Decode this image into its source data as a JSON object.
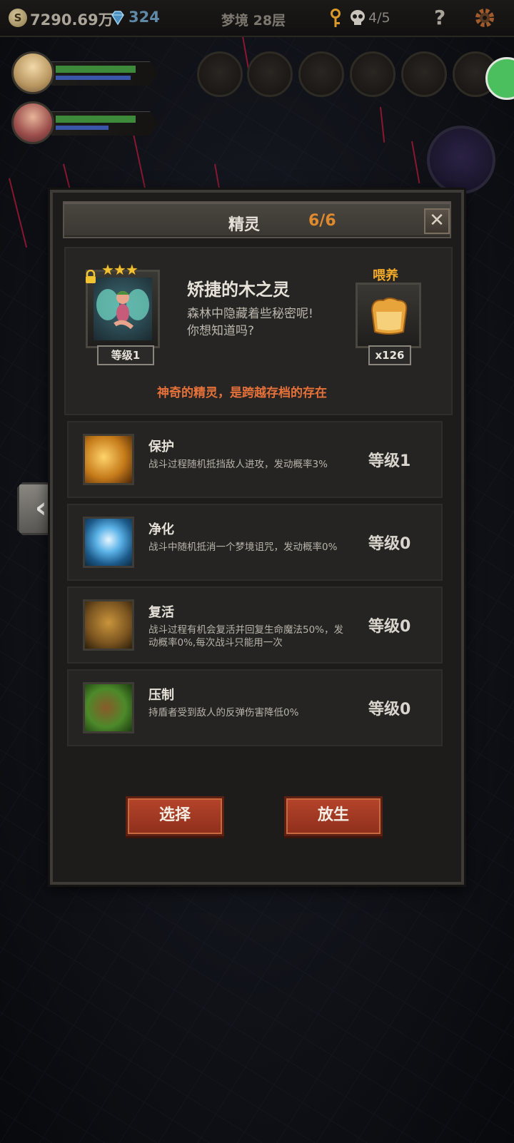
{
  "topbar": {
    "coin_symbol": "S",
    "gold": "7290.69万",
    "gems": "324",
    "floor": "梦境 28层",
    "keys": "4/5",
    "help_label": "?"
  },
  "heroes": [
    {
      "hp_fraction": 0.9,
      "mp_fraction": 0.85
    },
    {
      "hp_fraction": 0.9,
      "mp_fraction": 0.6
    }
  ],
  "dialog": {
    "title": "精灵",
    "count": "6/6",
    "close_label": "✕",
    "spirit": {
      "stars": "★★★",
      "level": "等级1",
      "name": "矫捷的木之灵",
      "desc_line1": "森林中隐藏着些秘密呢!",
      "desc_line2": "你想知道吗?",
      "feed_label": "喂养",
      "feed_count": "x126",
      "tagline": "神奇的精灵，是跨越存档的存在"
    },
    "skills": [
      {
        "name": "保护",
        "desc": "战斗过程随机抵挡敌人进攻，发动概率3%",
        "level": "等级1",
        "icon": "protect-icon"
      },
      {
        "name": "净化",
        "desc": "战斗中随机抵消一个梦境诅咒，发动概率0%",
        "level": "等级0",
        "icon": "purify-icon"
      },
      {
        "name": "复活",
        "desc": "战斗过程有机会复活并回复生命魔法50%，发动概率0%,每次战斗只能用一次",
        "level": "等级0",
        "icon": "revive-icon"
      },
      {
        "name": "压制",
        "desc": "持盾者受到敌人的反弹伤害降低0%",
        "level": "等级0",
        "icon": "suppress-icon"
      }
    ],
    "select_label": "选择",
    "release_label": "放生"
  },
  "nav": {
    "prev_label": "‹"
  },
  "colors": {
    "accent_orange": "#e08a2e",
    "button_red": "#b5442a",
    "feed_gold": "#f0a928"
  }
}
